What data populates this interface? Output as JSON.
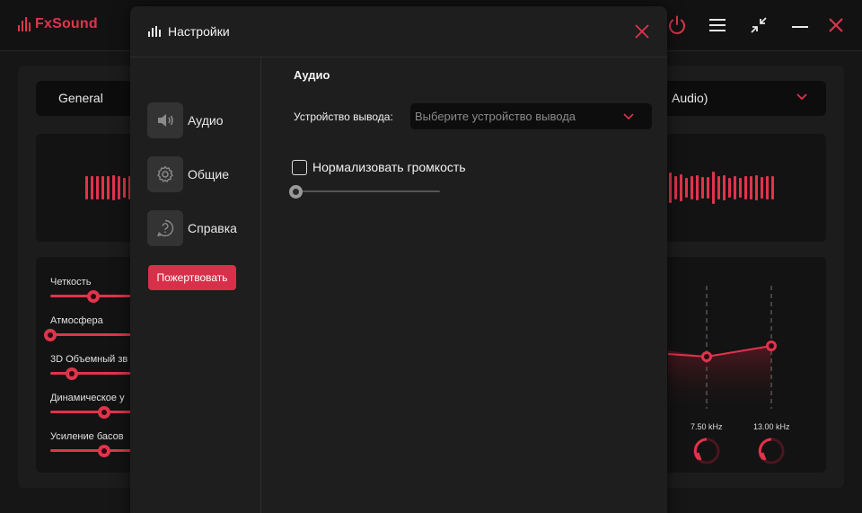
{
  "app": {
    "logo_text": "FxSound",
    "brand_color": "#e0344c",
    "top_controls": [
      "power-icon",
      "menu-icon",
      "minimize-window-icon",
      "minimize-icon",
      "close-icon"
    ],
    "preset": {
      "label": "General",
      "output_partial": "Audio)"
    },
    "effects": [
      {
        "label": "Четкость",
        "value": 0.53
      },
      {
        "label": "Атмосфера",
        "value": 0.0
      },
      {
        "label": "3D Объемный зв",
        "value": 0.27
      },
      {
        "label": "Динамическое у",
        "value": 0.67
      },
      {
        "label": "Усиление басов",
        "value": 0.67
      }
    ],
    "eq": {
      "bands": [
        {
          "freq": "7.50 kHz"
        },
        {
          "freq": "13.00 kHz"
        }
      ]
    }
  },
  "settings": {
    "title": "Настройки",
    "nav": [
      {
        "label": "Аудио",
        "icon": "speaker-icon"
      },
      {
        "label": "Общие",
        "icon": "gear-icon"
      },
      {
        "label": "Справка",
        "icon": "help-icon"
      }
    ],
    "donate_label": "Пожертвовать",
    "section_title": "Аудио",
    "output_label": "Устройство вывода:",
    "output_placeholder": "Выберите устройство вывода",
    "normalize_label": "Нормализовать громкость",
    "normalize_checked": false,
    "volume_value": 0
  }
}
